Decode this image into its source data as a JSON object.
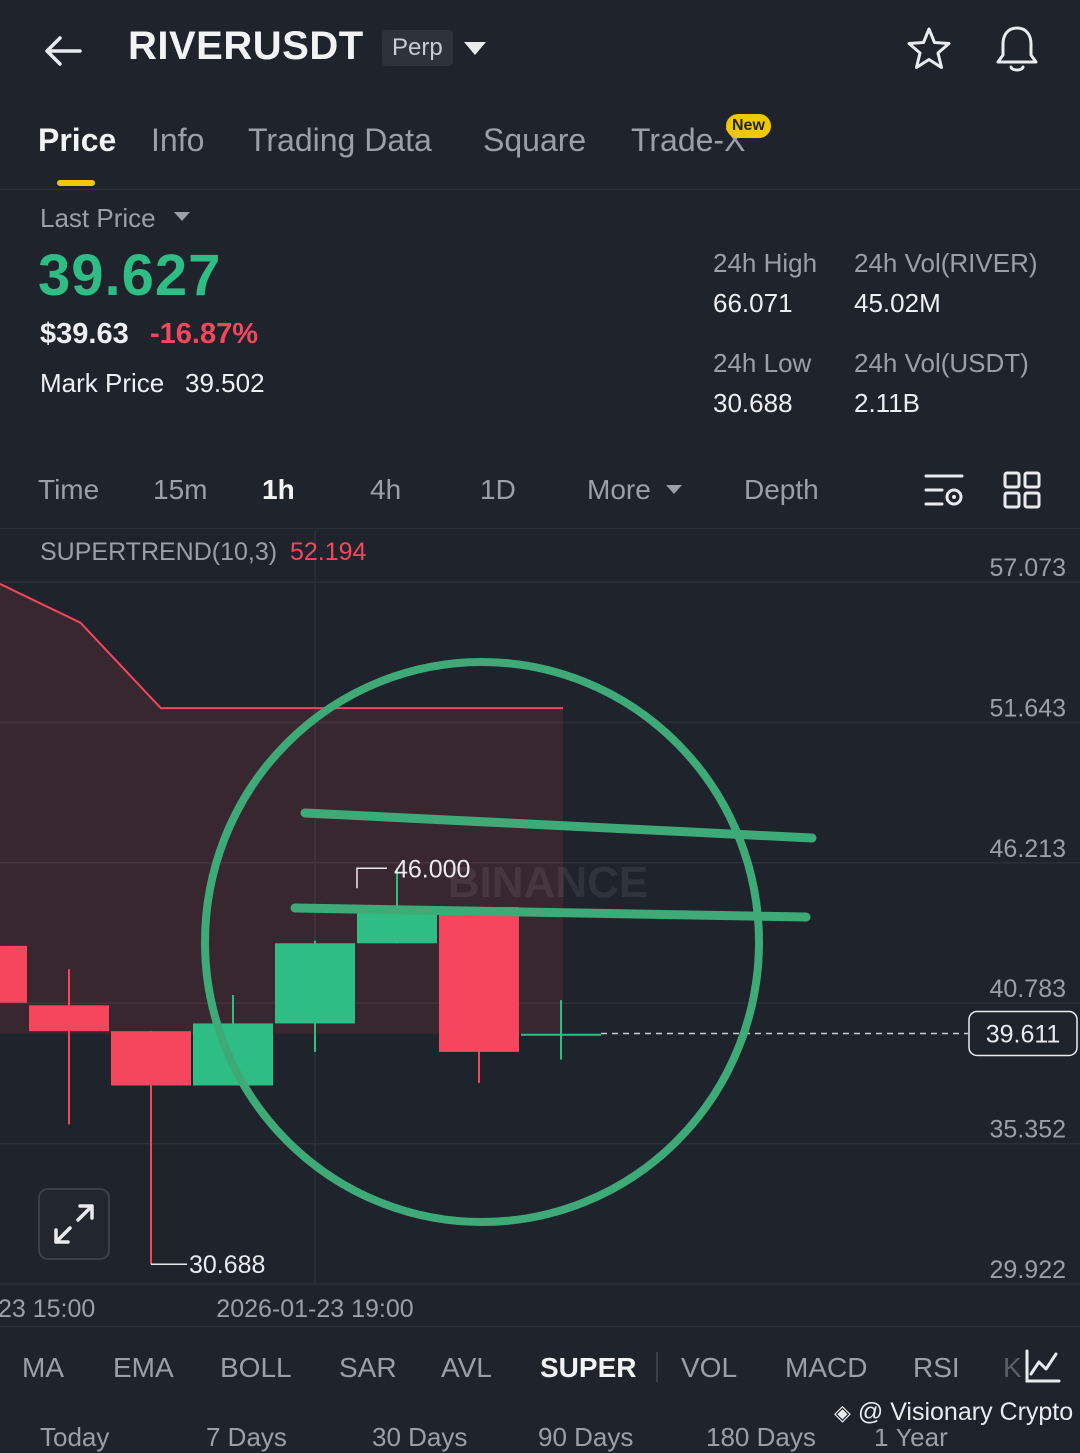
{
  "header": {
    "symbol": "RIVERUSDT",
    "badge": "Perp"
  },
  "tabs": [
    {
      "label": "Price",
      "active": true
    },
    {
      "label": "Info"
    },
    {
      "label": "Trading Data"
    },
    {
      "label": "Square"
    },
    {
      "label": "Trade-X",
      "badge": "New"
    }
  ],
  "price": {
    "last_price_label": "Last Price",
    "last_price": "39.627",
    "usd_price": "$39.63",
    "change": "-16.87%",
    "mark_price_label": "Mark Price",
    "mark_price": "39.502"
  },
  "stats": {
    "high_label": "24h High",
    "high": "66.071",
    "vol_river_label": "24h Vol(RIVER)",
    "vol_river": "45.02M",
    "low_label": "24h Low",
    "low": "30.688",
    "vol_usdt_label": "24h Vol(USDT)",
    "vol_usdt": "2.11B"
  },
  "intervals": {
    "items": [
      "Time",
      "15m",
      "1h",
      "4h",
      "1D",
      "More",
      "Depth"
    ],
    "active": "1h"
  },
  "chart": {
    "indicator_label": "SUPERTREND(10,3)",
    "indicator_value": "52.194",
    "current_price_tag": "39.611",
    "watermark": "BINANCE",
    "colors": {
      "up": "#2ebd85",
      "down": "#f6465d",
      "annotation": "#3daa78"
    }
  },
  "chart_data": {
    "type": "candlestick",
    "y_ticks": [
      "57.073",
      "51.643",
      "46.213",
      "40.783",
      "35.352",
      "29.922"
    ],
    "ylim": [
      29.922,
      57.073
    ],
    "x_ticks": [
      "23 15:00",
      "2026-01-23 19:00"
    ],
    "high_marker": "46.000",
    "low_marker": "30.688",
    "candles": [
      {
        "open": 43.0,
        "close": 40.8,
        "high": 43.0,
        "low": 40.8
      },
      {
        "open": 40.7,
        "close": 39.7,
        "high": 42.1,
        "low": 36.1
      },
      {
        "open": 39.7,
        "close": 37.6,
        "high": 39.7,
        "low": 30.688
      },
      {
        "open": 37.6,
        "close": 40.0,
        "high": 41.1,
        "low": 37.6
      },
      {
        "open": 40.0,
        "close": 43.1,
        "high": 43.2,
        "low": 38.9
      },
      {
        "open": 43.1,
        "close": 44.5,
        "high": 46.0,
        "low": 43.1
      },
      {
        "open": 44.5,
        "close": 38.9,
        "high": 44.5,
        "low": 37.7
      },
      {
        "open": 39.6,
        "close": 39.6,
        "high": 40.9,
        "low": 38.6
      }
    ],
    "supertrend": [
      57.0,
      55.5,
      52.194,
      52.194,
      52.194,
      52.194,
      52.194,
      52.194
    ]
  },
  "indicator_tabs": {
    "items": [
      "MA",
      "EMA",
      "BOLL",
      "SAR",
      "AVL",
      "SUPER",
      "VOL",
      "MACD",
      "RSI",
      "K"
    ],
    "active": "SUPER"
  },
  "range_tabs": [
    "Today",
    "7 Days",
    "30 Days",
    "90 Days",
    "180 Days",
    "1 Year"
  ],
  "footer": {
    "watermark": "@ Visionary Crypto"
  }
}
